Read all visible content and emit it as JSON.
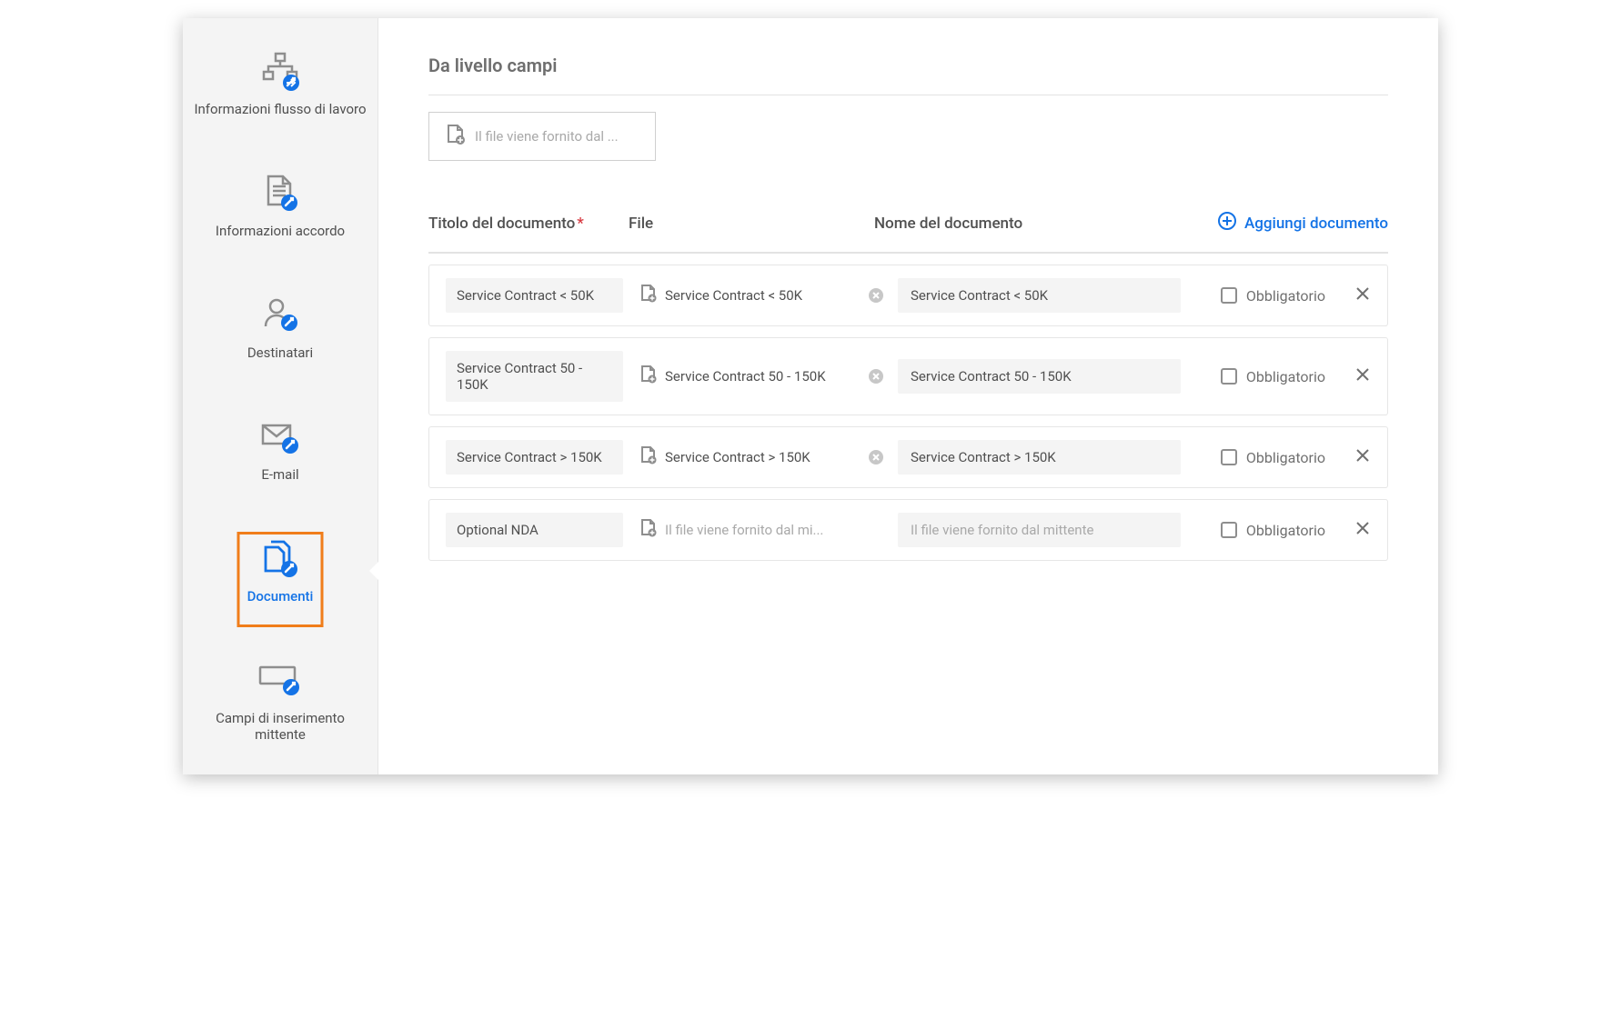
{
  "sidebar": {
    "items": [
      {
        "id": "workflow-info",
        "label": "Informazioni flusso di lavoro"
      },
      {
        "id": "agreement-info",
        "label": "Informazioni accordo"
      },
      {
        "id": "recipients",
        "label": "Destinatari"
      },
      {
        "id": "email",
        "label": "E-mail"
      },
      {
        "id": "documents",
        "label": "Documenti",
        "active": true
      },
      {
        "id": "sender-fields",
        "label": "Campi di inserimento mittente"
      }
    ]
  },
  "main": {
    "section_title": "Da livello campi",
    "file_slot_placeholder": "Il file viene fornito dal ...",
    "columns": {
      "title": "Titolo del documento",
      "file": "File",
      "name": "Nome del documento"
    },
    "add_document_label": "Aggiungi documento",
    "mandatory_label": "Obbligatorio",
    "file_placeholder_short": "Il file viene fornito dal mi...",
    "file_placeholder_full": "Il file viene fornito dal mittente",
    "rows": [
      {
        "title": "Service Contract < 50K",
        "file": "Service Contract < 50K",
        "name": "Service Contract < 50K",
        "has_file": true
      },
      {
        "title": "Service Contract 50 - 150K",
        "file": "Service Contract 50 - 150K",
        "name": "Service Contract 50 - 150K",
        "has_file": true
      },
      {
        "title": "Service Contract > 150K",
        "file": "Service Contract > 150K",
        "name": "Service Contract > 150K",
        "has_file": true
      },
      {
        "title": "Optional NDA",
        "file": "",
        "name": "",
        "has_file": false
      }
    ]
  },
  "colors": {
    "accent_blue": "#1473e6",
    "orange_highlight": "#f07d1a",
    "grey_bg": "#f4f4f4"
  }
}
